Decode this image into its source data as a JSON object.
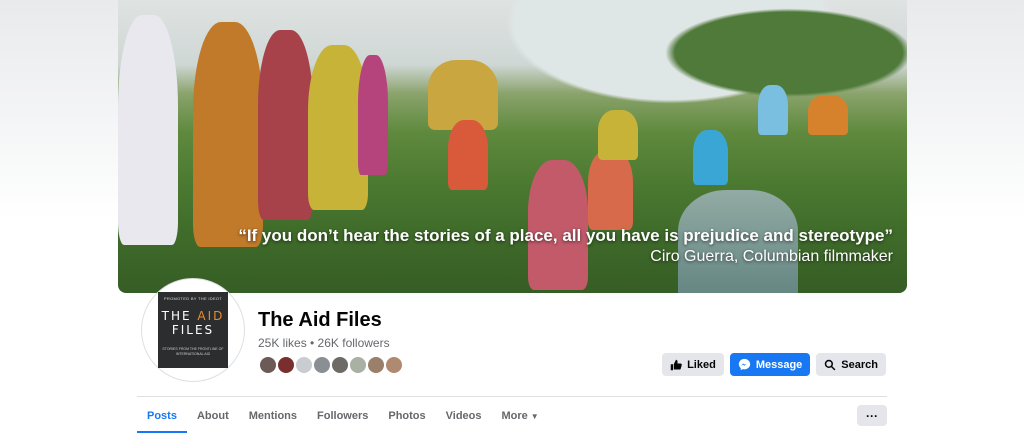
{
  "cover": {
    "quote": "“If you don’t hear the stories of a place, all you have is prejudice and stereotype”",
    "attribution": "Ciro Guerra, Columbian filmmaker"
  },
  "avatar": {
    "promo": "PROMOTED BY THE IDEOT",
    "title_word_1": "THE ",
    "title_word_2": "AID",
    "title_line_2": "FILES",
    "tagline": "STORIES FROM THE FRONTLINE OF INTERNATIONAL AID",
    "accent_color": "#e88b2e"
  },
  "page": {
    "name": "The Aid Files",
    "stats": "25K likes • 26K followers"
  },
  "friend_avatars": [
    "#6b5a55",
    "#7a2f2f",
    "#c9ccd1",
    "#8a8f94",
    "#6e6a66",
    "#a9b0a4",
    "#9a7f6a",
    "#b08a70"
  ],
  "actions": {
    "liked_label": "Liked",
    "message_label": "Message",
    "search_label": "Search"
  },
  "tabs": [
    {
      "label": "Posts"
    },
    {
      "label": "About"
    },
    {
      "label": "Mentions"
    },
    {
      "label": "Followers"
    },
    {
      "label": "Photos"
    },
    {
      "label": "Videos"
    },
    {
      "label": "More"
    }
  ],
  "more_menu_label": "···",
  "colors": {
    "brand_blue": "#1877f2",
    "button_grey": "#e4e6eb",
    "muted_text": "#65676b"
  }
}
